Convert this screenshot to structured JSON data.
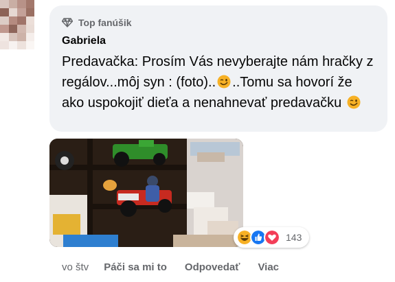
{
  "comment": {
    "badge": "Top fanúšik",
    "author": "Gabriela",
    "text_part1": "Predavačka: Prosím Vás nevyberajte nám hračky z regálov...môj syn : (foto)..",
    "text_part2": "..Tomu sa hovorí že ako uspokojiť dieťa a nenahnevať predavačku ",
    "emoji_1": "winking-face-icon",
    "emoji_2": "winking-face-icon",
    "reactions": {
      "icons": [
        "laughing-reaction-icon",
        "like-reaction-icon",
        "love-reaction-icon"
      ],
      "count": "143"
    }
  },
  "actions": {
    "time": "vo štv",
    "like": "Páči sa mi to",
    "reply": "Odpovedať",
    "more": "Viac"
  },
  "colors": {
    "bubble": "#f0f2f5",
    "secondary_text": "#65676b",
    "like_blue": "#1877f2",
    "love_red": "#f33e58",
    "haha_yellow": "#f7b125"
  }
}
